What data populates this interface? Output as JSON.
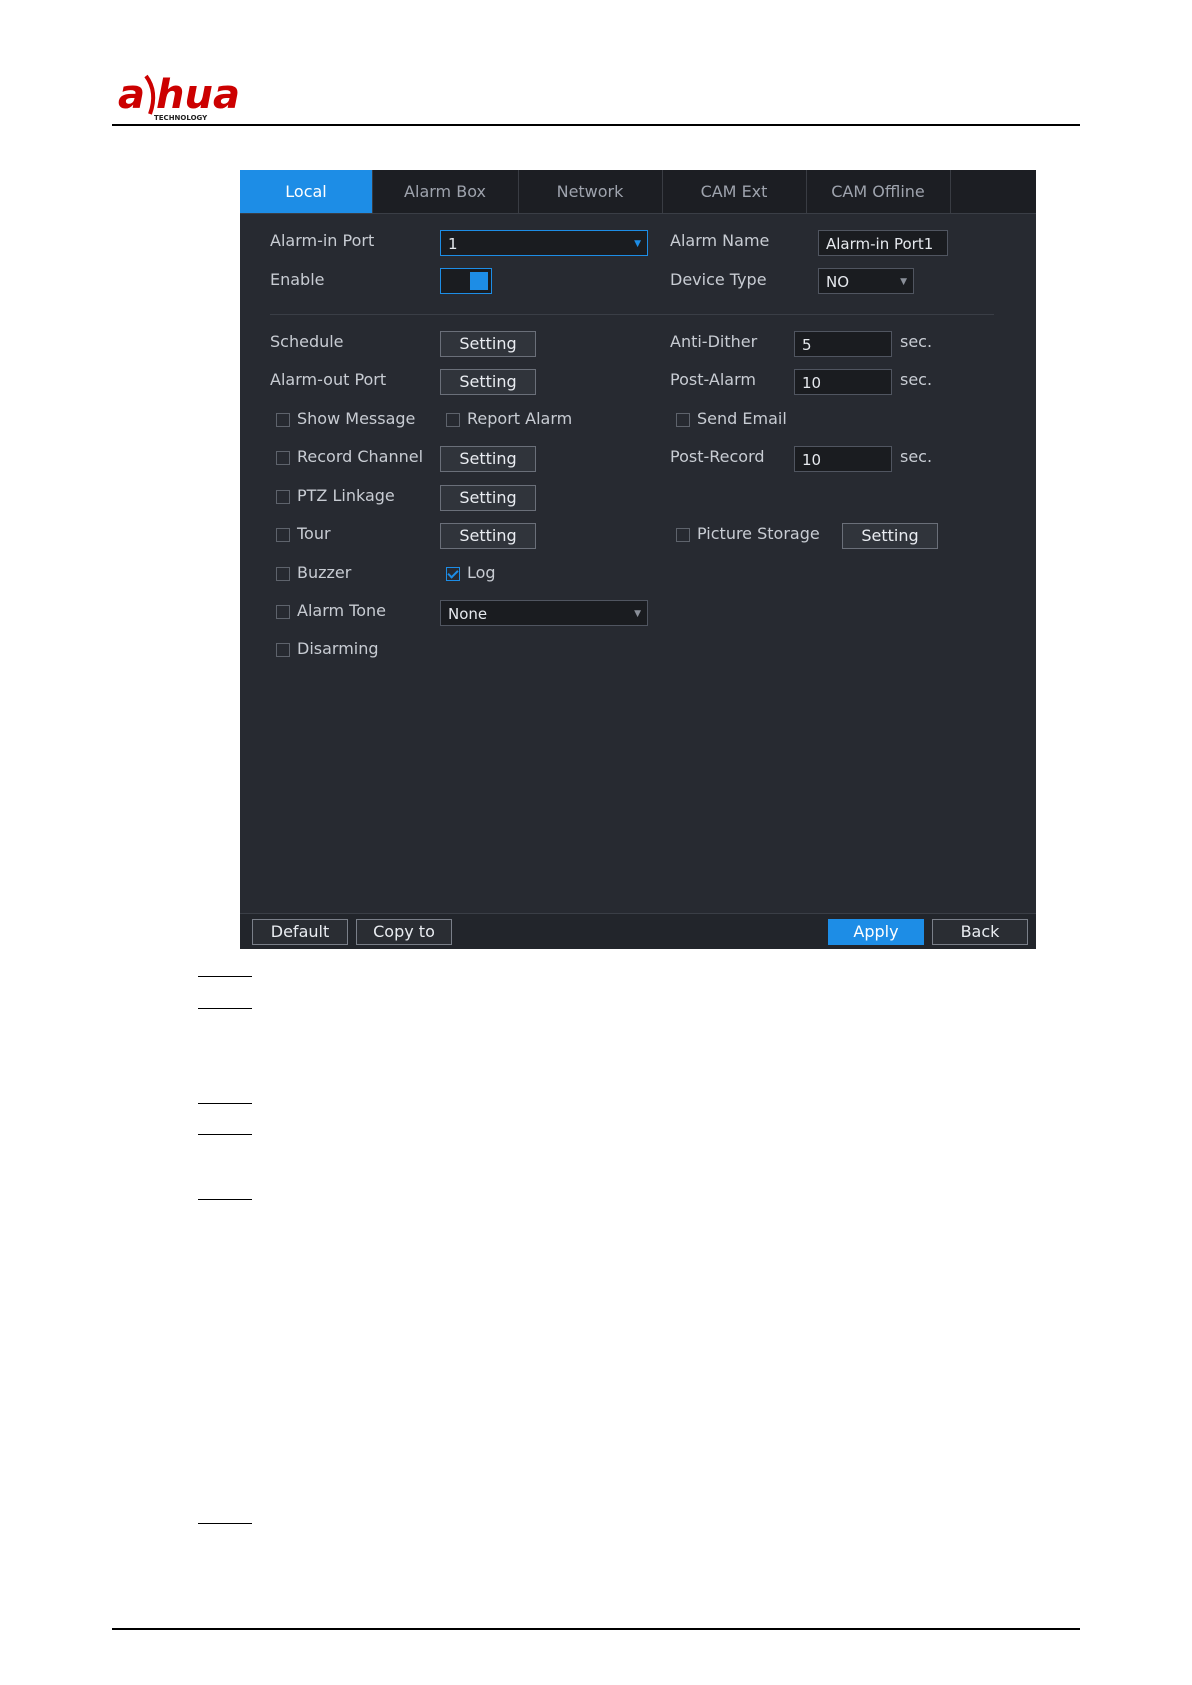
{
  "brand": {
    "logo_text": "alhua",
    "logo_sub": "TECHNOLOGY",
    "logo_color": "#cc0000"
  },
  "tabs": [
    {
      "label": "Local",
      "active": true
    },
    {
      "label": "Alarm Box",
      "active": false
    },
    {
      "label": "Network",
      "active": false
    },
    {
      "label": "CAM Ext",
      "active": false
    },
    {
      "label": "CAM Offline",
      "active": false
    }
  ],
  "form": {
    "alarm_in_port": {
      "label": "Alarm-in Port",
      "value": "1"
    },
    "alarm_name": {
      "label": "Alarm Name",
      "value": "Alarm-in Port1"
    },
    "enable": {
      "label": "Enable",
      "on": true
    },
    "device_type": {
      "label": "Device Type",
      "value": "NO"
    },
    "schedule": {
      "label": "Schedule",
      "button": "Setting"
    },
    "anti_dither": {
      "label": "Anti-Dither",
      "value": "5",
      "unit": "sec."
    },
    "alarm_out_port": {
      "label": "Alarm-out Port",
      "button": "Setting"
    },
    "post_alarm": {
      "label": "Post-Alarm",
      "value": "10",
      "unit": "sec."
    },
    "show_message": {
      "label": "Show Message",
      "checked": false
    },
    "report_alarm": {
      "label": "Report Alarm",
      "checked": false
    },
    "send_email": {
      "label": "Send Email",
      "checked": false
    },
    "record_channel": {
      "label": "Record Channel",
      "checked": false,
      "button": "Setting"
    },
    "post_record": {
      "label": "Post-Record",
      "value": "10",
      "unit": "sec."
    },
    "ptz_linkage": {
      "label": "PTZ Linkage",
      "checked": false,
      "button": "Setting"
    },
    "tour": {
      "label": "Tour",
      "checked": false,
      "button": "Setting"
    },
    "picture_storage": {
      "label": "Picture Storage",
      "checked": false,
      "button": "Setting"
    },
    "buzzer": {
      "label": "Buzzer",
      "checked": false
    },
    "log": {
      "label": "Log",
      "checked": true
    },
    "alarm_tone": {
      "label": "Alarm Tone",
      "checked": false,
      "value": "None"
    },
    "disarming": {
      "label": "Disarming",
      "checked": false
    }
  },
  "footer": {
    "default": "Default",
    "copy_to": "Copy to",
    "apply": "Apply",
    "back": "Back"
  },
  "colors": {
    "accent": "#1d8de6",
    "panel_bg": "#272a31"
  }
}
